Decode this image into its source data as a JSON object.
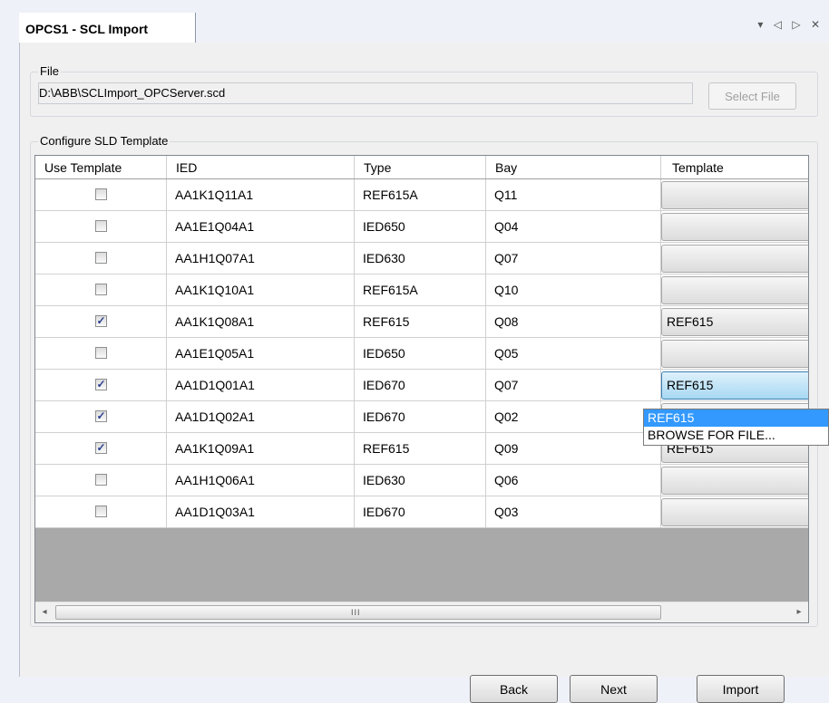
{
  "tab": {
    "title": "OPCS1 - SCL Import",
    "controls": [
      "▾",
      "◁",
      "▷",
      "✕"
    ]
  },
  "file_group": {
    "title": "File",
    "path": "D:\\ABB\\SCLImport_OPCServer.scd",
    "select_label": "Select File"
  },
  "sld_group": {
    "title": "Configure SLD Template"
  },
  "grid": {
    "headers": [
      "Use Template",
      "IED",
      "Type",
      "Bay",
      "Template"
    ],
    "rows": [
      {
        "checked": false,
        "ied": "AA1K1Q11A1",
        "type": "REF615A",
        "bay": "Q11",
        "template": ""
      },
      {
        "checked": false,
        "ied": "AA1E1Q04A1",
        "type": "IED650",
        "bay": "Q04",
        "template": ""
      },
      {
        "checked": false,
        "ied": "AA1H1Q07A1",
        "type": "IED630",
        "bay": "Q07",
        "template": ""
      },
      {
        "checked": false,
        "ied": "AA1K1Q10A1",
        "type": "REF615A",
        "bay": "Q10",
        "template": ""
      },
      {
        "checked": true,
        "ied": "AA1K1Q08A1",
        "type": "REF615",
        "bay": "Q08",
        "template": "REF615"
      },
      {
        "checked": false,
        "ied": "AA1E1Q05A1",
        "type": "IED650",
        "bay": "Q05",
        "template": ""
      },
      {
        "checked": true,
        "ied": "AA1D1Q01A1",
        "type": "IED670",
        "bay": "Q07",
        "template": "REF615",
        "active": true
      },
      {
        "checked": true,
        "ied": "AA1D1Q02A1",
        "type": "IED670",
        "bay": "Q02",
        "template": ""
      },
      {
        "checked": true,
        "ied": "AA1K1Q09A1",
        "type": "REF615",
        "bay": "Q09",
        "template": "REF615"
      },
      {
        "checked": false,
        "ied": "AA1H1Q06A1",
        "type": "IED630",
        "bay": "Q06",
        "template": ""
      },
      {
        "checked": false,
        "ied": "AA1D1Q03A1",
        "type": "IED670",
        "bay": "Q03",
        "template": ""
      }
    ],
    "dropdown": {
      "options": [
        "REF615",
        "BROWSE FOR FILE..."
      ],
      "selected": "REF615"
    },
    "scrollbar": {
      "left": "◂",
      "right": "▸",
      "grip": "III"
    }
  },
  "buttons": {
    "back": "Back",
    "next": "Next",
    "import": "Import"
  }
}
